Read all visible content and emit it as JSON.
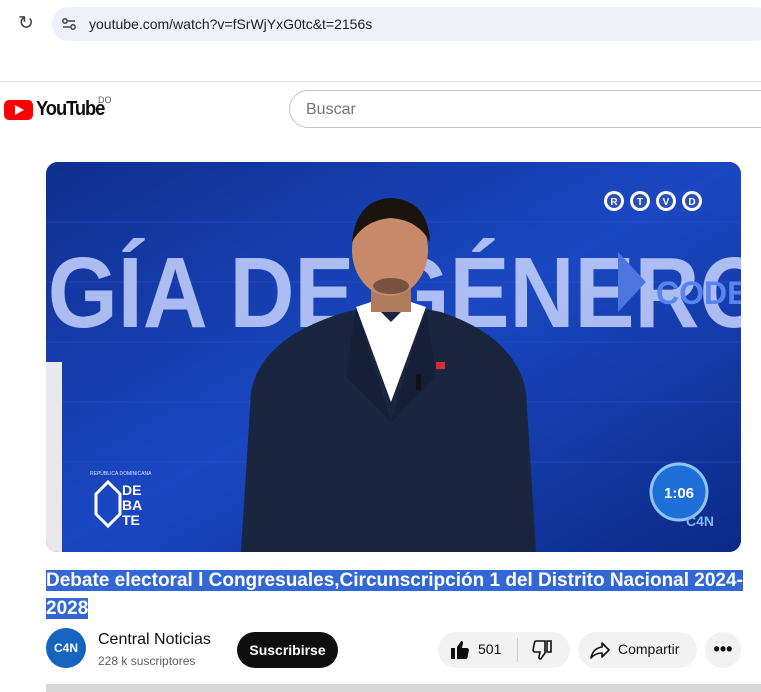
{
  "browser": {
    "url": "youtube.com/watch?v=fSrWjYxG0tc&t=2156s"
  },
  "header": {
    "logo_text": "YouTube",
    "country_code": "DO",
    "search_placeholder": "Buscar"
  },
  "video": {
    "overlay_text": "GÍA DE GÉNERO",
    "side_text": "CODE",
    "rtvd": [
      "R",
      "T",
      "V",
      "D"
    ],
    "debate_caption": "REPÚBLICA DOMINICANA",
    "debate_lines": [
      "DE",
      "BA",
      "TE"
    ],
    "timer": "1:06",
    "network_logo": "C4N"
  },
  "title": "Debate electoral l Congresuales,Circunscripción 1 del Distrito Nacional 2024-2028",
  "channel": {
    "name": "Central Noticias",
    "subscribers": "228 k suscriptores",
    "avatar_text": "C4N"
  },
  "actions": {
    "subscribe": "Suscribirse",
    "likes": "501",
    "share": "Compartir",
    "more": "•••"
  },
  "colors": {
    "accent": "#ff0000",
    "selection": "#3367d6",
    "video_bg": "#1238a0"
  }
}
